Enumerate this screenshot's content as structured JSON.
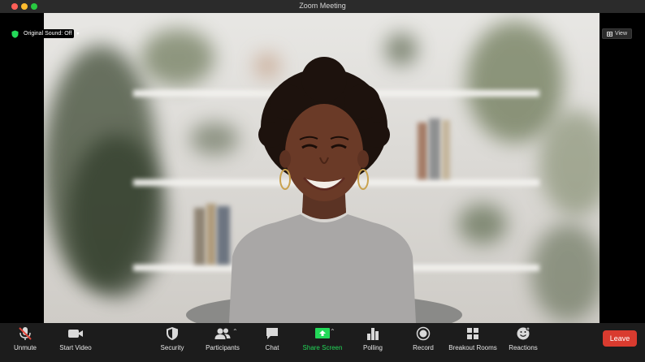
{
  "window": {
    "title": "Zoom Meeting"
  },
  "overlay": {
    "original_sound_label": "Original Sound: Off",
    "view_label": "View"
  },
  "toolbar": {
    "unmute": "Unmute",
    "start_video": "Start Video",
    "security": "Security",
    "participants": "Participants",
    "chat": "Chat",
    "share_screen": "Share Screen",
    "polling": "Polling",
    "record": "Record",
    "breakout_rooms": "Breakout Rooms",
    "reactions": "Reactions",
    "leave": "Leave"
  },
  "colors": {
    "accent_green": "#23d959",
    "leave_red": "#d93b2f",
    "toolbar_bg": "#1c1c1c"
  }
}
